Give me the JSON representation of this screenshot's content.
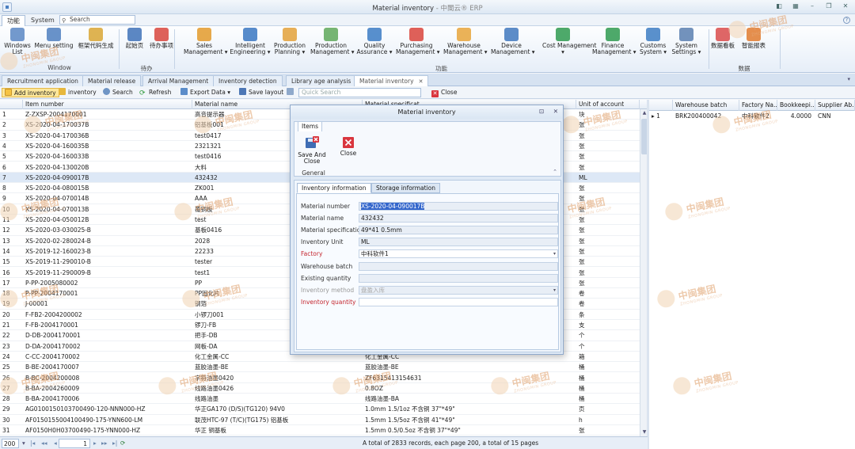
{
  "window": {
    "title": "Material inventory",
    "subtitle": "- 中閩云® ERP"
  },
  "menu": {
    "tabs": [
      {
        "label": "功能"
      },
      {
        "label": "System"
      }
    ],
    "search_label": "Search"
  },
  "ribbon": {
    "buttons": [
      {
        "label": "Windows",
        "label2": "List"
      },
      {
        "label": "Menu setting",
        "label2": ""
      },
      {
        "label": "框架代码生成",
        "label2": ""
      },
      {
        "label": "起始页",
        "label2": ""
      },
      {
        "label": "待办事项",
        "label2": ""
      },
      {
        "label": "Sales",
        "label2": "Management ▾"
      },
      {
        "label": "Intelligent",
        "label2": "Engineering ▾"
      },
      {
        "label": "Production",
        "label2": "Planning ▾"
      },
      {
        "label": "Production",
        "label2": "Management ▾"
      },
      {
        "label": "Quality",
        "label2": "Assurance ▾"
      },
      {
        "label": "Purchasing",
        "label2": "Management ▾"
      },
      {
        "label": "Warehouse",
        "label2": "Management ▾"
      },
      {
        "label": "Device",
        "label2": "Management ▾"
      },
      {
        "label": "Cost Management",
        "label2": "▾"
      },
      {
        "label": "Finance",
        "label2": "Management ▾"
      },
      {
        "label": "Customs",
        "label2": "System ▾"
      },
      {
        "label": "System",
        "label2": "Settings ▾"
      },
      {
        "label": "数据看板",
        "label2": ""
      },
      {
        "label": "智能报表",
        "label2": ""
      }
    ],
    "groups": [
      {
        "label": "Window"
      },
      {
        "label": "待办"
      },
      {
        "label": "功能"
      },
      {
        "label": "数据"
      }
    ]
  },
  "doc_tabs": [
    {
      "label": "Recruitment application"
    },
    {
      "label": "Material release"
    },
    {
      "label": "Arrival Management"
    },
    {
      "label": "Inventory detection"
    },
    {
      "label": "Library age analysis"
    },
    {
      "label": "Material inventory"
    }
  ],
  "toolbar": {
    "add_inventory": "Add inventory",
    "inventory": "inventory",
    "search": "Search",
    "refresh": "Refresh",
    "export": "Export Data",
    "save_layout": "Save layout",
    "quick_search_placeholder": "Quick Search",
    "close": "Close"
  },
  "grid": {
    "columns": [
      "Item number",
      "Material name",
      "Material specificat...",
      "Unit of account"
    ],
    "rows": [
      {
        "n": "1",
        "item": "Z-ZXSP-2004170001",
        "name": "高音提示器",
        "spec": "",
        "unit": "块"
      },
      {
        "n": "2",
        "item": "XS-2020-04-170037B",
        "name": "铝基板001",
        "spec": "",
        "unit": "张"
      },
      {
        "n": "3",
        "item": "XS-2020-04-170036B",
        "name": "test0417",
        "spec": "",
        "unit": "张"
      },
      {
        "n": "4",
        "item": "XS-2020-04-160035B",
        "name": "2321321",
        "spec": "",
        "unit": "张"
      },
      {
        "n": "5",
        "item": "XS-2020-04-160033B",
        "name": "test0416",
        "spec": "",
        "unit": "张"
      },
      {
        "n": "6",
        "item": "XS-2020-04-130020B",
        "name": "大料",
        "spec": "",
        "unit": "张"
      },
      {
        "n": "7",
        "item": "XS-2020-04-090017B",
        "name": "432432",
        "spec": "",
        "unit": "ML"
      },
      {
        "n": "8",
        "item": "XS-2020-04-080015B",
        "name": "ZK001",
        "spec": "",
        "unit": "张"
      },
      {
        "n": "9",
        "item": "XS-2020-04-070014B",
        "name": "AAA",
        "spec": "",
        "unit": "张"
      },
      {
        "n": "10",
        "item": "XS-2020-04-070013B",
        "name": "覆铜板",
        "spec": "",
        "unit": "张"
      },
      {
        "n": "11",
        "item": "XS-2020-04-050012B",
        "name": "test",
        "spec": "",
        "unit": "张"
      },
      {
        "n": "12",
        "item": "XS-2020-03-030025-B",
        "name": "基板0416",
        "spec": "",
        "unit": "张"
      },
      {
        "n": "13",
        "item": "XS-2020-02-280024-B",
        "name": "2028",
        "spec": "",
        "unit": "张"
      },
      {
        "n": "14",
        "item": "XS-2019-12-160023-B",
        "name": "22233",
        "spec": "",
        "unit": "张"
      },
      {
        "n": "15",
        "item": "XS-2019-11-290010-B",
        "name": "tester",
        "spec": "",
        "unit": "张"
      },
      {
        "n": "16",
        "item": "XS-2019-11-290009-B",
        "name": "test1",
        "spec": "",
        "unit": "张"
      },
      {
        "n": "17",
        "item": "P-PP-2005080002",
        "name": "PP",
        "spec": "",
        "unit": "张"
      },
      {
        "n": "18",
        "item": "P-PP-2004170001",
        "name": "PP固化片",
        "spec": "",
        "unit": "卷"
      },
      {
        "n": "19",
        "item": "J-00001",
        "name": "钢箔",
        "spec": "",
        "unit": "卷"
      },
      {
        "n": "20",
        "item": "F-FB2-2004200002",
        "name": "小锣刀001",
        "spec": "",
        "unit": "条"
      },
      {
        "n": "21",
        "item": "F-FB-2004170001",
        "name": "锣刀-FB",
        "spec": "",
        "unit": "支"
      },
      {
        "n": "22",
        "item": "D-DB-2004170001",
        "name": "把手-DB",
        "spec": "",
        "unit": "个"
      },
      {
        "n": "23",
        "item": "D-DA-2004170002",
        "name": "网板-DA",
        "spec": "",
        "unit": "个"
      },
      {
        "n": "24",
        "item": "C-CC-2004170002",
        "name": "化工金属-CC",
        "spec": "化工金属-CC",
        "unit": "箱"
      },
      {
        "n": "25",
        "item": "B-BE-2004170007",
        "name": "蓝胶油墨-BE",
        "spec": "蓝胶油墨-BE",
        "unit": "桶"
      },
      {
        "n": "26",
        "item": "B-BC-2004200008",
        "name": "字符油墨0420",
        "spec": "ZF6315413154631",
        "unit": "桶"
      },
      {
        "n": "27",
        "item": "B-BA-2004260009",
        "name": "线路油墨0426",
        "spec": "0.8OZ",
        "unit": "桶"
      },
      {
        "n": "28",
        "item": "B-BA-2004170006",
        "name": "线路油墨",
        "spec": "线路油墨-BA",
        "unit": "桶"
      },
      {
        "n": "29",
        "item": "AG0100150103700490-120-NNN000-HZ",
        "name": "华正GA170 (D/S)(TG120)  94V0",
        "spec": "1.0mm 1.5/1oz 不含铜 37\"*49\"",
        "unit": "页"
      },
      {
        "n": "30",
        "item": "AF0150155004100490-175-YNN600-LM",
        "name": "联茂HTC-97 (T/C)(TG175) 铝基板",
        "spec": "1.5mm 1.5/5oz 不含铜 41\"*49\"",
        "unit": "h"
      },
      {
        "n": "31",
        "item": "AF0150H0H03700490-175-YNN000-HZ",
        "name": "华正 铜基板",
        "spec": "1.5mm 0.5/0.5oz 不含铜 37\"*49\"",
        "unit": "张"
      }
    ]
  },
  "right_grid": {
    "columns": [
      "Warehouse batch",
      "Factory Na...",
      "Bookkeepi...",
      "Supplier Ab..."
    ],
    "row": {
      "marker": "▸ 1",
      "batch": "BRK200400042",
      "factory": "中科软件2",
      "qty": "4.0000",
      "supplier": "CNN"
    }
  },
  "status": {
    "page_size": "200",
    "page": "1",
    "summary": "A total of 2833 records, each page 200, a total of 15 pages"
  },
  "dialog": {
    "title": "Material inventory",
    "ribbon_tab": "Items",
    "save_close": "Save And Close",
    "close": "Close",
    "group": "General",
    "tabs": [
      "Inventory information",
      "Storage information"
    ],
    "fields": [
      {
        "label": "Material number",
        "value": "XS-2020-04-090017B"
      },
      {
        "label": "Material name",
        "value": "432432"
      },
      {
        "label": "Material specification",
        "value": "49*41 0.5mm"
      },
      {
        "label": "Inventory Unit",
        "value": "ML"
      },
      {
        "label": "Factory",
        "value": "中科软件1"
      },
      {
        "label": "Warehouse batch",
        "value": ""
      },
      {
        "label": "Existing quantity",
        "value": ""
      },
      {
        "label": "Inventory method",
        "value": "盘盈入库"
      },
      {
        "label": "Inventory quantity",
        "value": ""
      }
    ]
  },
  "watermark": {
    "text": "中闽集团",
    "en": "ZHONGMIN GROUP"
  }
}
